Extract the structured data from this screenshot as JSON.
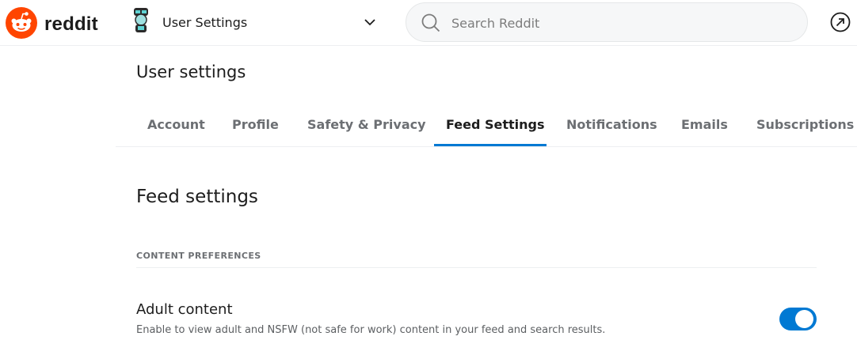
{
  "header": {
    "logo_text": "reddit",
    "logo_icon": "reddit-alien-icon",
    "switcher_label": "User Settings",
    "switcher_avatar": "snoo-avatar-icon",
    "search_placeholder": "Search Reddit",
    "search_icon": "search-icon",
    "popular_icon": "arrow-up-right-circle-icon"
  },
  "page": {
    "title": "User settings",
    "tabs": [
      {
        "label": "Account",
        "active": false
      },
      {
        "label": "Profile",
        "active": false
      },
      {
        "label": "Safety & Privacy",
        "active": false
      },
      {
        "label": "Feed Settings",
        "active": true
      },
      {
        "label": "Notifications",
        "active": false
      },
      {
        "label": "Emails",
        "active": false
      },
      {
        "label": "Subscriptions",
        "active": false
      }
    ]
  },
  "feed": {
    "section_title": "Feed settings",
    "subheading": "CONTENT PREFERENCES",
    "options": [
      {
        "title": "Adult content",
        "description": "Enable to view adult and NSFW (not safe for work) content in your feed and search results.",
        "enabled": true
      }
    ]
  },
  "colors": {
    "brand": "#ff4500",
    "accent": "#0079d3",
    "text": "#1c1c1c",
    "muted": "#6c6f73"
  }
}
